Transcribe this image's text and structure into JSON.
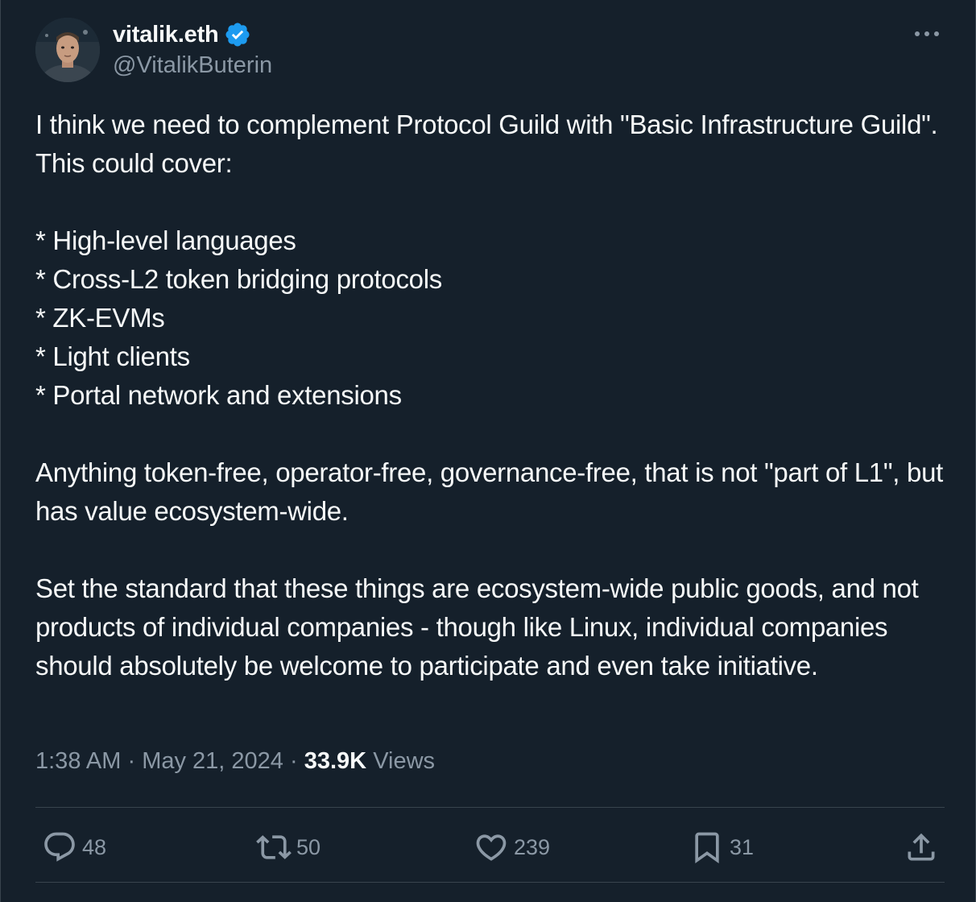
{
  "author": {
    "display_name": "vitalik.eth",
    "handle": "@VitalikButerin",
    "verified": true
  },
  "tweet": {
    "text": "I think we need to complement Protocol Guild with \"Basic Infrastructure Guild\". This could cover:\n\n* High-level languages\n* Cross-L2 token bridging protocols\n* ZK-EVMs\n* Light clients\n* Portal network and extensions\n\nAnything token-free, operator-free, governance-free, that is not \"part of L1\", but has value ecosystem-wide.\n\nSet the standard that these things are ecosystem-wide public goods, and not products of individual companies - though like Linux, individual companies should absolutely be welcome to participate and even take initiative.",
    "time": "1:38 AM",
    "date": "May 21, 2024",
    "separator": "·",
    "views_count": "33.9K",
    "views_label": "Views"
  },
  "actions": {
    "replies": "48",
    "reposts": "50",
    "likes": "239",
    "bookmarks": "31"
  },
  "icons": {
    "verified": "verified-badge-icon",
    "more": "more-icon",
    "reply": "reply-icon",
    "repost": "repost-icon",
    "like": "heart-icon",
    "bookmark": "bookmark-icon",
    "share": "share-icon"
  },
  "colors": {
    "background": "#15202b",
    "text": "#f7f9f9",
    "secondary": "#8b98a5",
    "verified": "#1d9bf0",
    "border": "#38444d"
  }
}
